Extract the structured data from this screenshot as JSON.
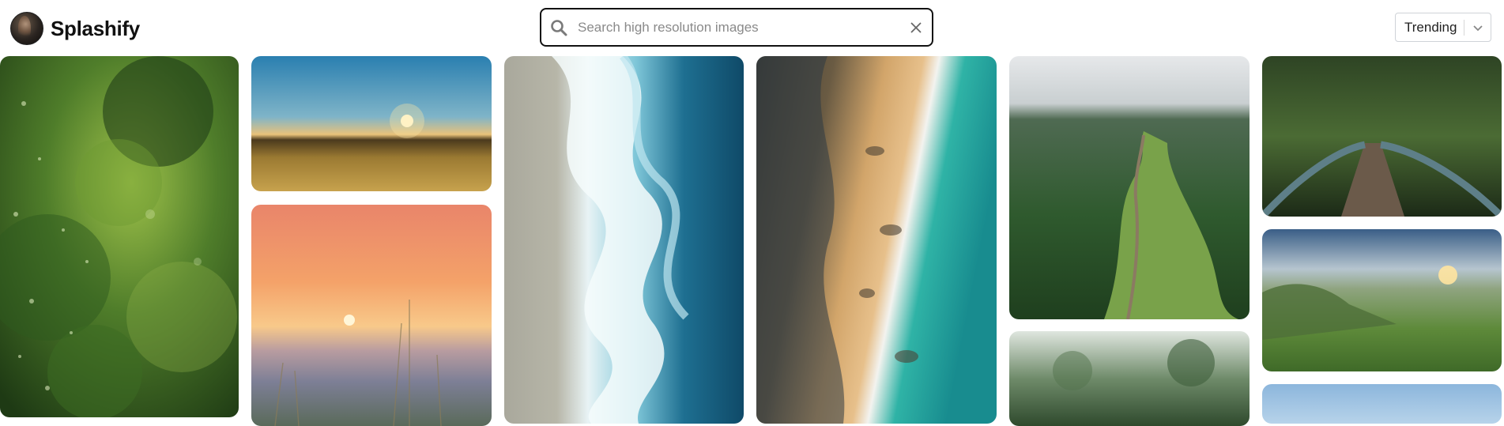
{
  "header": {
    "brand": "Splashify",
    "search_placeholder": "Search high resolution images",
    "search_value": "",
    "sort_selected": "Trending"
  },
  "icons": {
    "logo": "avatar-logo",
    "search": "search-icon",
    "clear": "close-icon",
    "dropdown": "chevron-down-icon"
  },
  "gallery": {
    "photos": [
      {
        "subject": "green leaves with bokeh"
      },
      {
        "subject": "sunset over golden wheat field"
      },
      {
        "subject": "sunset over meadow with grasses"
      },
      {
        "subject": "aerial ocean waves on shore"
      },
      {
        "subject": "aerial rocky beach and turquoise sea"
      },
      {
        "subject": "trail along green mountain ridge"
      },
      {
        "subject": "wooden bridge in forest"
      },
      {
        "subject": "misty green cliffs at sunrise"
      },
      {
        "subject": "forest treetops"
      },
      {
        "subject": "blue sky landscape"
      }
    ]
  }
}
